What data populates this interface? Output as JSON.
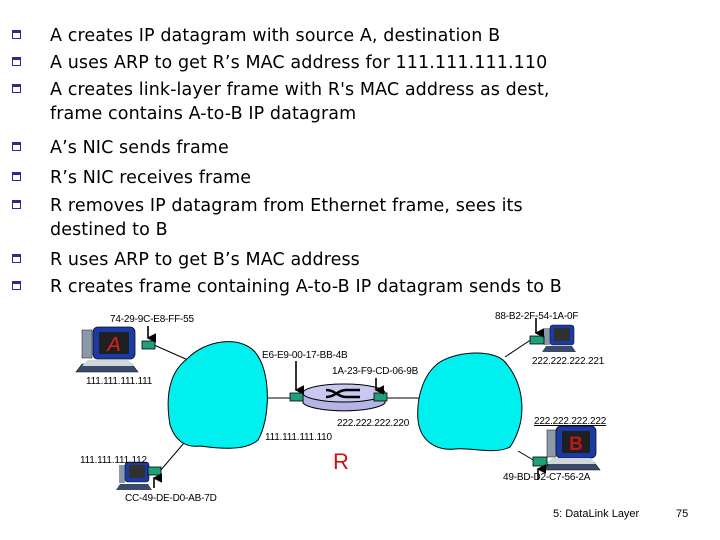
{
  "bullets": [
    "A creates IP datagram with source A, destination B",
    "A uses ARP to get R’s MAC address for 111.111.111.110",
    "A creates link-layer frame with R's MAC address as dest,",
    "frame contains A-to-B IP datagram",
    "A’s NIC sends frame",
    "R’s NIC receives frame",
    "R removes IP datagram from Ethernet frame, sees its",
    "destined to B",
    "R uses ARP to get B’s MAC address",
    "R creates frame containing A-to-B IP datagram sends to B"
  ],
  "diagram": {
    "host_a": {
      "name": "A",
      "mac": "74-29-9C-E8-FF-55",
      "ip": "111.111.111.111"
    },
    "host_left_bottom": {
      "mac": "CC-49-DE-D0-AB-7D",
      "ip": "111.111.111.112"
    },
    "router": {
      "name": "R",
      "left_mac": "E6-E9-00-17-BB-4B",
      "left_ip": "111.111.111.110",
      "right_mac": "1A-23-F9-CD-06-9B",
      "right_ip": "222.222.222.220"
    },
    "host_right_top": {
      "mac": "88-B2-2F-54-1A-0F",
      "ip": "222.222.222.221"
    },
    "host_b": {
      "name": "B",
      "mac": "49-BD-D2-C7-56-2A",
      "ip": "222.222.222.222"
    },
    "colors": {
      "lan": "#00f0f0",
      "nic": "#1ea07a",
      "router_body": "#c8c8f0",
      "name_red": "#d01010"
    }
  },
  "footer": {
    "chapter": "5: DataLink Layer",
    "page": "75"
  }
}
